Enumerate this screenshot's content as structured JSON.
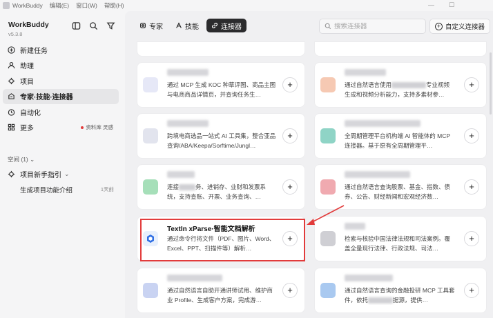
{
  "menubar": {
    "app": "WorkBuddy",
    "items": [
      "编辑(E)",
      "窗口(W)",
      "帮助(H)"
    ],
    "minimize": "—",
    "maximize": "☐"
  },
  "sidebar": {
    "app_name": "WorkBuddy",
    "version": "v5.3.8",
    "nav": [
      {
        "label": "新建任务",
        "icon": "plus-circle-icon"
      },
      {
        "label": "助理",
        "icon": "person-icon"
      },
      {
        "label": "项目",
        "icon": "project-icon"
      },
      {
        "label": "专家·技能·连接器",
        "icon": "experts-icon",
        "active": true
      },
      {
        "label": "自动化",
        "icon": "clock-icon"
      },
      {
        "label": "更多",
        "icon": "grid-icon",
        "badge": "资料库 灵感"
      }
    ],
    "space_label": "空间 (1)",
    "project_guide": "项目新手指引",
    "session": {
      "title": "生成项目功能介绍",
      "time": "1天前"
    }
  },
  "main": {
    "tabs": [
      {
        "label": "专家",
        "icon": "expert-icon"
      },
      {
        "label": "技能",
        "icon": "skill-icon"
      },
      {
        "label": "连接器",
        "icon": "link-icon",
        "active": true
      }
    ],
    "search_placeholder": "搜索连接器",
    "custom_button": "自定义连接器",
    "add_symbol": "+",
    "cards": [
      {
        "desc_a": "通过 MCP 生成 KOC 种草评图、商品主图与电商商品详情页，并查询任务生…",
        "color": "#e6e8f7"
      },
      {
        "desc_a": "通过自然语言使用",
        "desc_b": "专业视频生成和视频分析能力，支持多素材参…",
        "color": "#f6c9b3"
      },
      {
        "desc_a": "跨境电商选品一站式 AI 工具集，整合亚品查询/ABA/Keepa/Sorftime/Jungl…",
        "color": "#e2e4ee"
      },
      {
        "desc_a": "全周期管理平台机构端 AI 智能体的 MCP 连接器。基于原有全周期管理平…",
        "color": "#8fd4c6"
      },
      {
        "desc_a": "连接",
        "desc_b": "务、进销存、业财和发票系统，支持查账、开票、业务查询、…",
        "color": "#a6dfb9"
      },
      {
        "desc_a": "通过自然语言查询股票、基金、指数、债券、公告、财经新闻和宏观经济数…",
        "color": "#f0aab0"
      },
      {
        "title": "TextIn xParse·智能文档解析",
        "desc_a": "通过命令行将文件（PDF、图片、Word、Excel、PPT、扫描件等）解析…",
        "color": "#e8f0fc"
      },
      {
        "desc_a": "检索与核验中国法律法规和司法案例。覆盖全量现行法律、行政法规、司法…",
        "color": "#cfcfd4"
      },
      {
        "desc_a": "通过自然语言自助开通讲师试用、维护商业 Profile、生成客户方案，完成游…",
        "color": "#c9d3f2"
      },
      {
        "desc_a": "通过自然语言查询的金融投研 MCP 工具套件，依托",
        "desc_b": "据源，提供…",
        "color": "#a9c9f0"
      }
    ]
  }
}
